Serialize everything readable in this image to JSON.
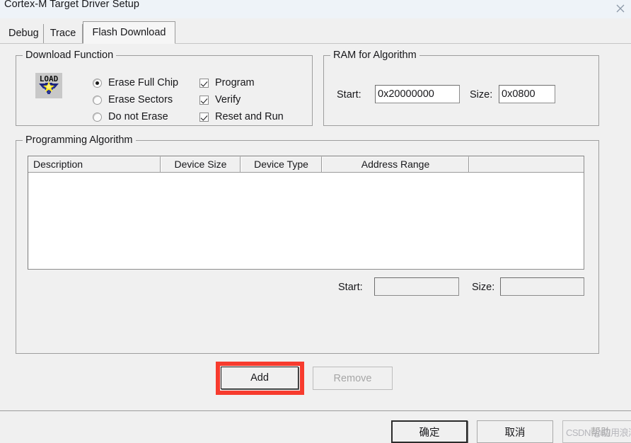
{
  "window": {
    "title": "Cortex-M Target Driver Setup",
    "close_icon": "close-icon"
  },
  "tabs": [
    {
      "label": "Debug",
      "active": false
    },
    {
      "label": "Trace",
      "active": false
    },
    {
      "label": "Flash Download",
      "active": true
    }
  ],
  "download_function": {
    "title": "Download Function",
    "icon": "load-icon",
    "icon_text": "LOAD",
    "erase_options": [
      {
        "label": "Erase Full Chip",
        "selected": true
      },
      {
        "label": "Erase Sectors",
        "selected": false
      },
      {
        "label": "Do not Erase",
        "selected": false
      }
    ],
    "checkboxes": [
      {
        "label": "Program",
        "checked": true
      },
      {
        "label": "Verify",
        "checked": true
      },
      {
        "label": "Reset and Run",
        "checked": true
      }
    ]
  },
  "ram_for_algorithm": {
    "title": "RAM for Algorithm",
    "start_label": "Start:",
    "start_value": "0x20000000",
    "size_label": "Size:",
    "size_value": "0x0800"
  },
  "programming_algorithm": {
    "title": "Programming Algorithm",
    "columns": [
      "Description",
      "Device Size",
      "Device Type",
      "Address Range",
      ""
    ],
    "rows": [],
    "start_label": "Start:",
    "start_value": "",
    "size_label": "Size:",
    "size_value": "",
    "add_label": "Add",
    "remove_label": "Remove",
    "remove_enabled": false
  },
  "footer": {
    "ok_label": "确定",
    "cancel_label": "取消",
    "help_label": "帮助",
    "help_enabled": false
  },
  "watermark": {
    "text": "CSDN @应用浪潮"
  },
  "colors": {
    "annotation_red": "#f73b2e",
    "dialog_bg": "#f0f0f0",
    "titlebar_bg": "#eef3f8",
    "field_bg": "#ffffff"
  }
}
